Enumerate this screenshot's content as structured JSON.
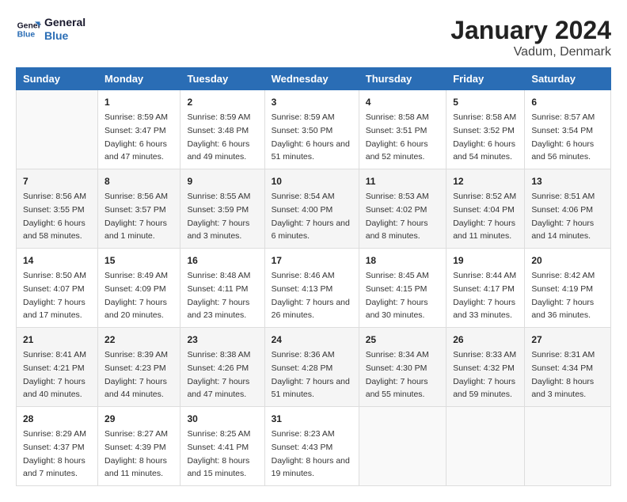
{
  "logo": {
    "line1": "General",
    "line2": "Blue"
  },
  "title": "January 2024",
  "subtitle": "Vadum, Denmark",
  "header": {
    "days": [
      "Sunday",
      "Monday",
      "Tuesday",
      "Wednesday",
      "Thursday",
      "Friday",
      "Saturday"
    ]
  },
  "weeks": [
    [
      {
        "day": "",
        "sunrise": "",
        "sunset": "",
        "daylight": ""
      },
      {
        "day": "1",
        "sunrise": "Sunrise: 8:59 AM",
        "sunset": "Sunset: 3:47 PM",
        "daylight": "Daylight: 6 hours and 47 minutes."
      },
      {
        "day": "2",
        "sunrise": "Sunrise: 8:59 AM",
        "sunset": "Sunset: 3:48 PM",
        "daylight": "Daylight: 6 hours and 49 minutes."
      },
      {
        "day": "3",
        "sunrise": "Sunrise: 8:59 AM",
        "sunset": "Sunset: 3:50 PM",
        "daylight": "Daylight: 6 hours and 51 minutes."
      },
      {
        "day": "4",
        "sunrise": "Sunrise: 8:58 AM",
        "sunset": "Sunset: 3:51 PM",
        "daylight": "Daylight: 6 hours and 52 minutes."
      },
      {
        "day": "5",
        "sunrise": "Sunrise: 8:58 AM",
        "sunset": "Sunset: 3:52 PM",
        "daylight": "Daylight: 6 hours and 54 minutes."
      },
      {
        "day": "6",
        "sunrise": "Sunrise: 8:57 AM",
        "sunset": "Sunset: 3:54 PM",
        "daylight": "Daylight: 6 hours and 56 minutes."
      }
    ],
    [
      {
        "day": "7",
        "sunrise": "Sunrise: 8:56 AM",
        "sunset": "Sunset: 3:55 PM",
        "daylight": "Daylight: 6 hours and 58 minutes."
      },
      {
        "day": "8",
        "sunrise": "Sunrise: 8:56 AM",
        "sunset": "Sunset: 3:57 PM",
        "daylight": "Daylight: 7 hours and 1 minute."
      },
      {
        "day": "9",
        "sunrise": "Sunrise: 8:55 AM",
        "sunset": "Sunset: 3:59 PM",
        "daylight": "Daylight: 7 hours and 3 minutes."
      },
      {
        "day": "10",
        "sunrise": "Sunrise: 8:54 AM",
        "sunset": "Sunset: 4:00 PM",
        "daylight": "Daylight: 7 hours and 6 minutes."
      },
      {
        "day": "11",
        "sunrise": "Sunrise: 8:53 AM",
        "sunset": "Sunset: 4:02 PM",
        "daylight": "Daylight: 7 hours and 8 minutes."
      },
      {
        "day": "12",
        "sunrise": "Sunrise: 8:52 AM",
        "sunset": "Sunset: 4:04 PM",
        "daylight": "Daylight: 7 hours and 11 minutes."
      },
      {
        "day": "13",
        "sunrise": "Sunrise: 8:51 AM",
        "sunset": "Sunset: 4:06 PM",
        "daylight": "Daylight: 7 hours and 14 minutes."
      }
    ],
    [
      {
        "day": "14",
        "sunrise": "Sunrise: 8:50 AM",
        "sunset": "Sunset: 4:07 PM",
        "daylight": "Daylight: 7 hours and 17 minutes."
      },
      {
        "day": "15",
        "sunrise": "Sunrise: 8:49 AM",
        "sunset": "Sunset: 4:09 PM",
        "daylight": "Daylight: 7 hours and 20 minutes."
      },
      {
        "day": "16",
        "sunrise": "Sunrise: 8:48 AM",
        "sunset": "Sunset: 4:11 PM",
        "daylight": "Daylight: 7 hours and 23 minutes."
      },
      {
        "day": "17",
        "sunrise": "Sunrise: 8:46 AM",
        "sunset": "Sunset: 4:13 PM",
        "daylight": "Daylight: 7 hours and 26 minutes."
      },
      {
        "day": "18",
        "sunrise": "Sunrise: 8:45 AM",
        "sunset": "Sunset: 4:15 PM",
        "daylight": "Daylight: 7 hours and 30 minutes."
      },
      {
        "day": "19",
        "sunrise": "Sunrise: 8:44 AM",
        "sunset": "Sunset: 4:17 PM",
        "daylight": "Daylight: 7 hours and 33 minutes."
      },
      {
        "day": "20",
        "sunrise": "Sunrise: 8:42 AM",
        "sunset": "Sunset: 4:19 PM",
        "daylight": "Daylight: 7 hours and 36 minutes."
      }
    ],
    [
      {
        "day": "21",
        "sunrise": "Sunrise: 8:41 AM",
        "sunset": "Sunset: 4:21 PM",
        "daylight": "Daylight: 7 hours and 40 minutes."
      },
      {
        "day": "22",
        "sunrise": "Sunrise: 8:39 AM",
        "sunset": "Sunset: 4:23 PM",
        "daylight": "Daylight: 7 hours and 44 minutes."
      },
      {
        "day": "23",
        "sunrise": "Sunrise: 8:38 AM",
        "sunset": "Sunset: 4:26 PM",
        "daylight": "Daylight: 7 hours and 47 minutes."
      },
      {
        "day": "24",
        "sunrise": "Sunrise: 8:36 AM",
        "sunset": "Sunset: 4:28 PM",
        "daylight": "Daylight: 7 hours and 51 minutes."
      },
      {
        "day": "25",
        "sunrise": "Sunrise: 8:34 AM",
        "sunset": "Sunset: 4:30 PM",
        "daylight": "Daylight: 7 hours and 55 minutes."
      },
      {
        "day": "26",
        "sunrise": "Sunrise: 8:33 AM",
        "sunset": "Sunset: 4:32 PM",
        "daylight": "Daylight: 7 hours and 59 minutes."
      },
      {
        "day": "27",
        "sunrise": "Sunrise: 8:31 AM",
        "sunset": "Sunset: 4:34 PM",
        "daylight": "Daylight: 8 hours and 3 minutes."
      }
    ],
    [
      {
        "day": "28",
        "sunrise": "Sunrise: 8:29 AM",
        "sunset": "Sunset: 4:37 PM",
        "daylight": "Daylight: 8 hours and 7 minutes."
      },
      {
        "day": "29",
        "sunrise": "Sunrise: 8:27 AM",
        "sunset": "Sunset: 4:39 PM",
        "daylight": "Daylight: 8 hours and 11 minutes."
      },
      {
        "day": "30",
        "sunrise": "Sunrise: 8:25 AM",
        "sunset": "Sunset: 4:41 PM",
        "daylight": "Daylight: 8 hours and 15 minutes."
      },
      {
        "day": "31",
        "sunrise": "Sunrise: 8:23 AM",
        "sunset": "Sunset: 4:43 PM",
        "daylight": "Daylight: 8 hours and 19 minutes."
      },
      {
        "day": "",
        "sunrise": "",
        "sunset": "",
        "daylight": ""
      },
      {
        "day": "",
        "sunrise": "",
        "sunset": "",
        "daylight": ""
      },
      {
        "day": "",
        "sunrise": "",
        "sunset": "",
        "daylight": ""
      }
    ]
  ]
}
